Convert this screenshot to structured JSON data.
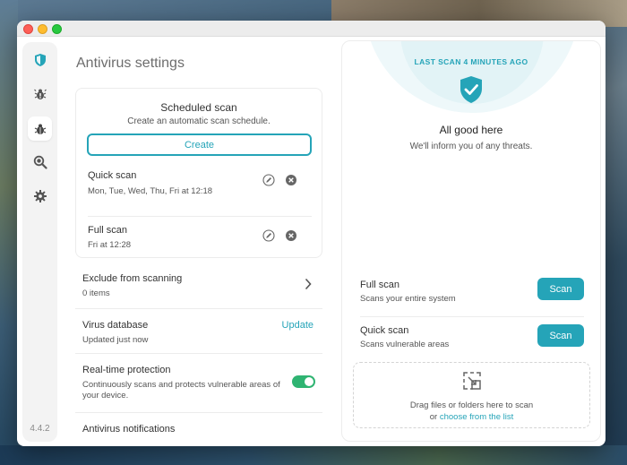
{
  "colors": {
    "accent": "#25a4b8",
    "toggle_on": "#2fb472",
    "text_primary": "#333333",
    "text_secondary": "#555555"
  },
  "sidebar": {
    "items": [
      {
        "icon": "shield-icon",
        "active": false
      },
      {
        "icon": "bug-alert-icon",
        "active": false
      },
      {
        "icon": "bug-icon",
        "active": true
      },
      {
        "icon": "search-bug-icon",
        "active": false
      },
      {
        "icon": "gear-icon",
        "active": false
      }
    ],
    "version": "4.4.2"
  },
  "settings": {
    "title": "Antivirus settings",
    "scheduled_scan": {
      "title": "Scheduled scan",
      "subtitle": "Create an automatic scan schedule.",
      "create_label": "Create",
      "schedules": [
        {
          "name": "Quick scan",
          "days": "Mon, Tue, Wed, Thu, Fri at 12:18"
        },
        {
          "name": "Full scan",
          "days": "Fri at 12:28"
        }
      ]
    },
    "exclude": {
      "title": "Exclude from scanning",
      "subtitle": "0 items"
    },
    "database": {
      "title": "Virus database",
      "subtitle": "Updated just now",
      "action": "Update"
    },
    "realtime": {
      "title": "Real-time protection",
      "subtitle": "Continuously scans and protects vulnerable areas of your device.",
      "enabled": true
    },
    "notifications": {
      "title": "Antivirus notifications"
    }
  },
  "status": {
    "last_scan": "LAST SCAN 4 MINUTES AGO",
    "headline": "All good here",
    "message": "We'll inform you of any threats."
  },
  "scans": {
    "full": {
      "title": "Full scan",
      "subtitle": "Scans your entire system",
      "button": "Scan"
    },
    "quick": {
      "title": "Quick scan",
      "subtitle": "Scans vulnerable areas",
      "button": "Scan"
    }
  },
  "dropzone": {
    "line1": "Drag files or folders here to scan",
    "or": "or ",
    "link": "choose from the list"
  }
}
